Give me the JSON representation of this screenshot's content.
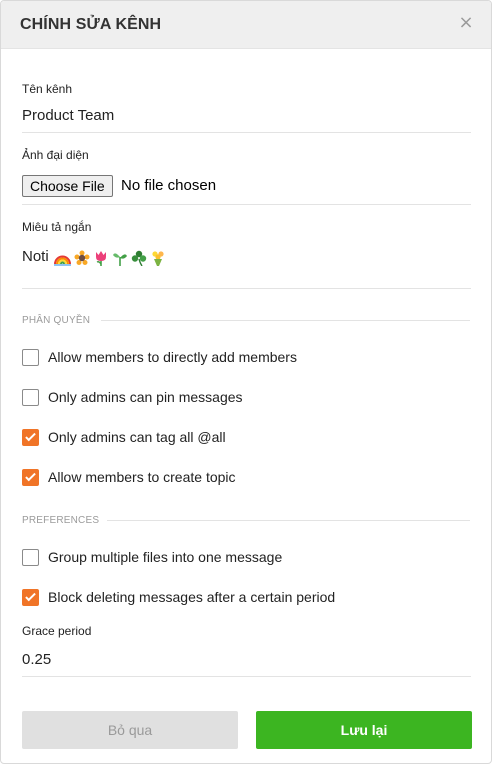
{
  "dialog": {
    "title": "CHÍNH SỬA KÊNH",
    "close_glyph": "×"
  },
  "fields": {
    "name_label": "Tên kênh",
    "name_value": "Product Team",
    "avatar_label": "Ảnh đại diện",
    "avatar_button": "Choose File",
    "avatar_status": "No file chosen",
    "desc_label": "Miêu tả ngắn",
    "desc_text": "Noti",
    "desc_emojis": [
      "rainbow-emoji",
      "sunflower-emoji",
      "tulip-emoji",
      "seedling-emoji",
      "shamrock-emoji",
      "bouquet-emoji"
    ]
  },
  "permissions": {
    "heading": "PHÂN QUYỀN",
    "items": [
      {
        "label": "Allow members to directly add members",
        "checked": false
      },
      {
        "label": "Only admins can pin messages",
        "checked": false
      },
      {
        "label": "Only admins can tag all @all",
        "checked": true
      },
      {
        "label": "Allow members to create topic",
        "checked": true
      }
    ]
  },
  "preferences": {
    "heading": "PREFERENCES",
    "items": [
      {
        "label": "Group multiple files into one message",
        "checked": false
      },
      {
        "label": "Block deleting messages after a certain period",
        "checked": true
      }
    ],
    "grace_label": "Grace period",
    "grace_value": "0.25"
  },
  "footer": {
    "cancel_label": "Bỏ qua",
    "save_label": "Lưu lại"
  },
  "colors": {
    "accent_checkbox": "#f07427",
    "save_button": "#3cb521",
    "cancel_button": "#e0e0e0"
  }
}
